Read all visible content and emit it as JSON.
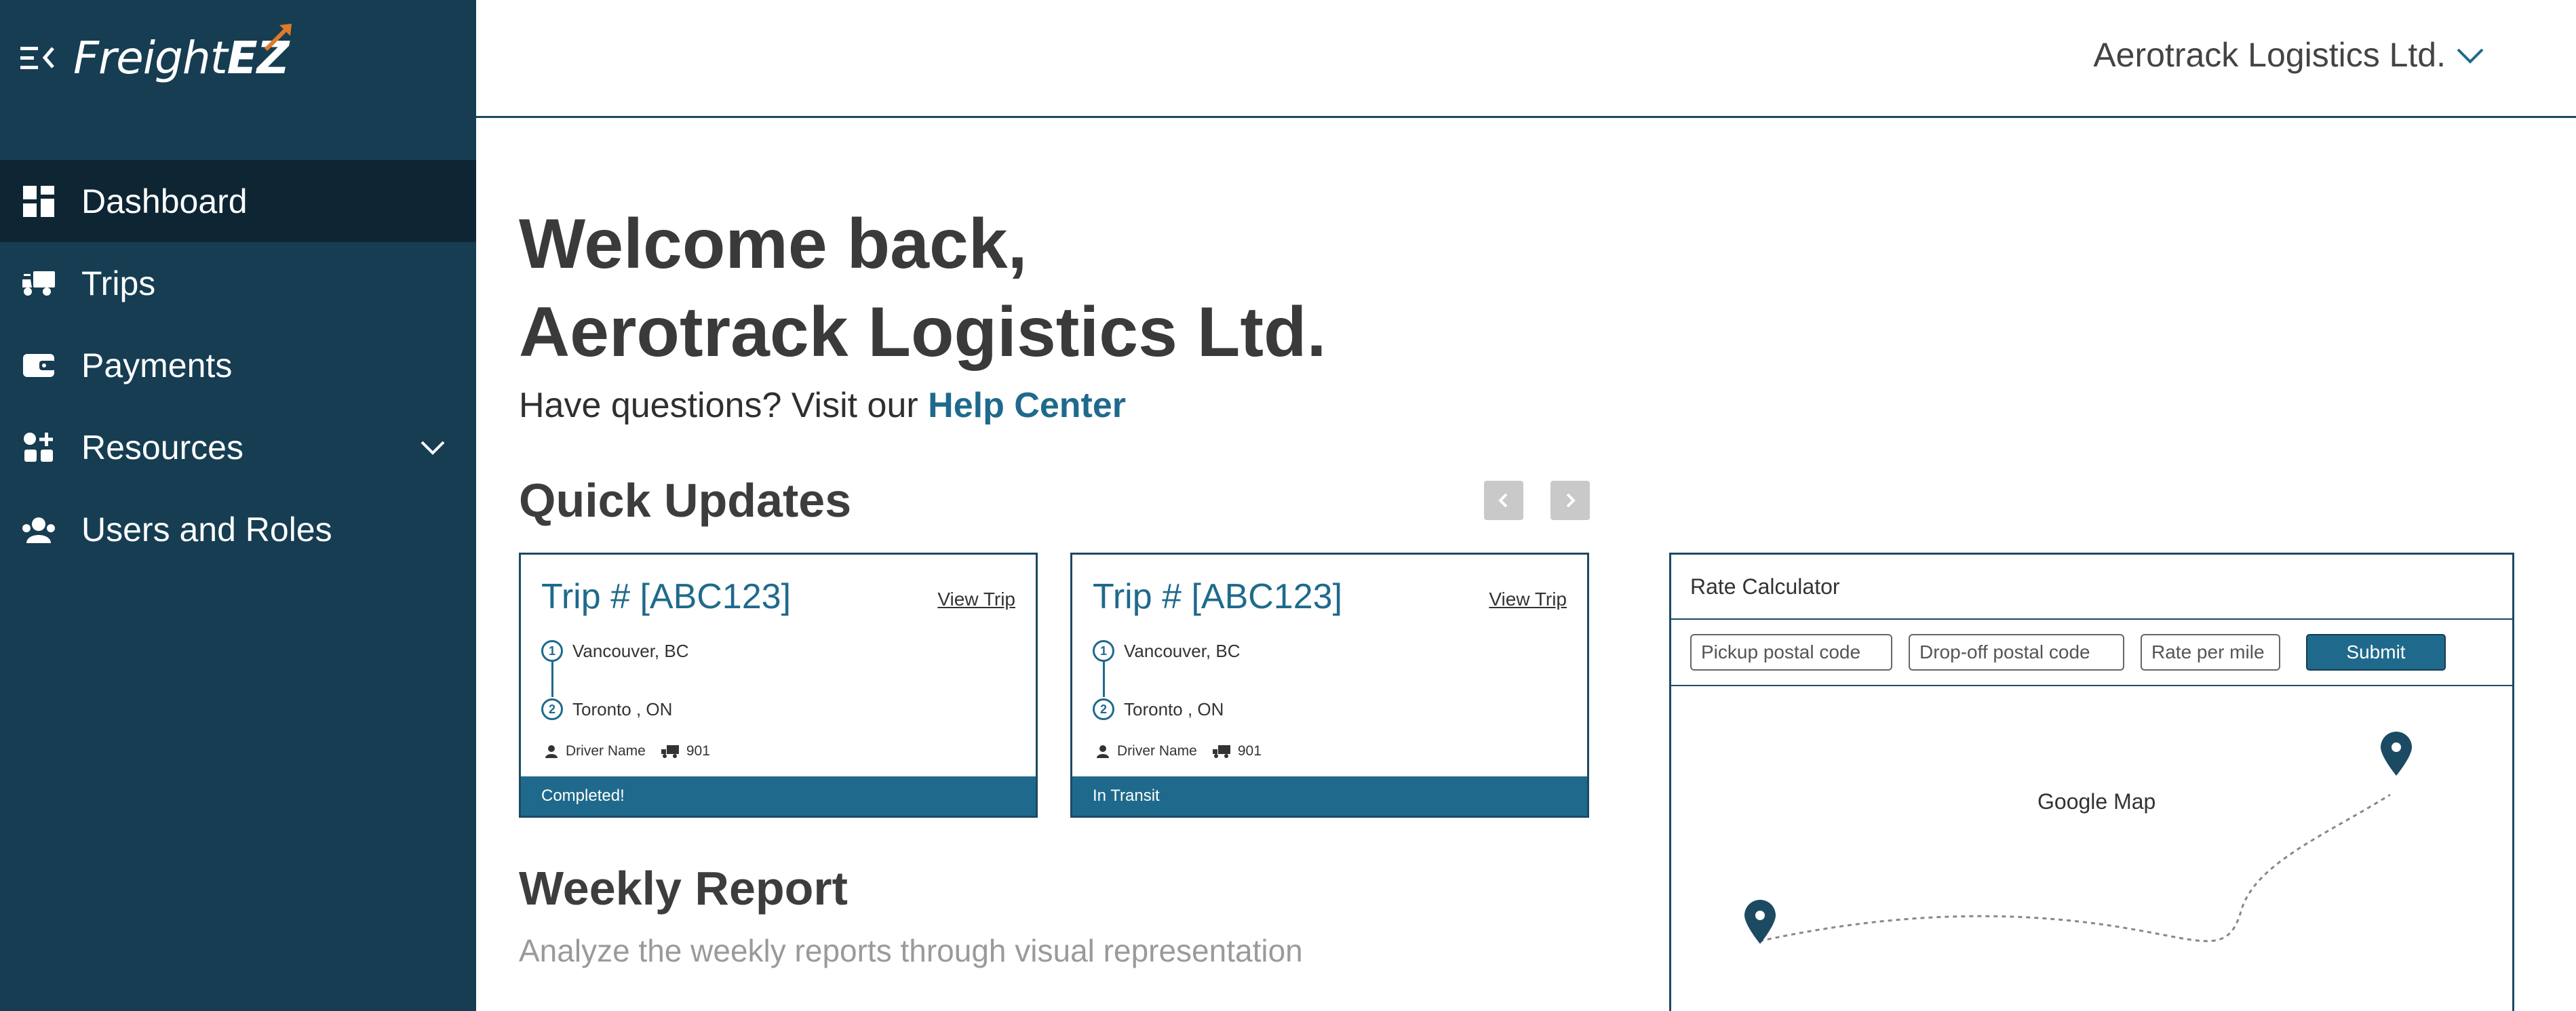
{
  "brand": {
    "name_light": "Freight",
    "name_bold": "EZ"
  },
  "sidebar": {
    "items": [
      {
        "label": "Dashboard",
        "icon": "dashboard-icon",
        "active": true
      },
      {
        "label": "Trips",
        "icon": "truck-icon"
      },
      {
        "label": "Payments",
        "icon": "wallet-icon"
      },
      {
        "label": "Resources",
        "icon": "resources-icon",
        "expandable": true
      },
      {
        "label": "Users and Roles",
        "icon": "users-icon"
      }
    ]
  },
  "header": {
    "account_name": "Aerotrack Logistics Ltd."
  },
  "welcome": {
    "line1": "Welcome back,",
    "line2": "Aerotrack Logistics Ltd.",
    "help_prefix": "Have questions? Visit our ",
    "help_link": "Help Center"
  },
  "quick_updates": {
    "title": "Quick Updates",
    "cards": [
      {
        "title": "Trip # [ABC123]",
        "view_label": "View Trip",
        "origin": "Vancouver, BC",
        "destination": "Toronto , ON",
        "driver": "Driver Name",
        "truck": "901",
        "status": "Completed!"
      },
      {
        "title": "Trip # [ABC123]",
        "view_label": "View Trip",
        "origin": "Vancouver, BC",
        "destination": "Toronto , ON",
        "driver": "Driver Name",
        "truck": "901",
        "status": "In Transit"
      }
    ]
  },
  "weekly_report": {
    "title": "Weekly Report",
    "subtitle": "Analyze the weekly reports through visual representation"
  },
  "rate_calculator": {
    "title": "Rate Calculator",
    "pickup_placeholder": "Pickup postal code",
    "dropoff_placeholder": "Drop-off postal code",
    "rate_placeholder": "Rate per mile",
    "submit_label": "Submit",
    "map_label": "Google Map"
  },
  "colors": {
    "sidebar": "#163d52",
    "sidebar_active": "#0e2633",
    "accent": "#1f6a8c",
    "logo_accent": "#e07b2a"
  }
}
